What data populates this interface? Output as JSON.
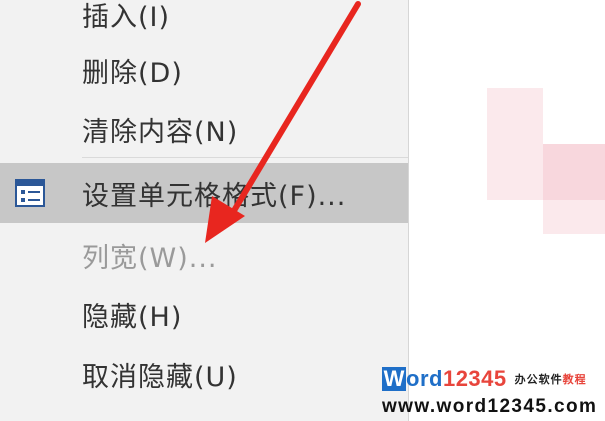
{
  "context_menu": {
    "items": [
      {
        "label": "插入(I)",
        "state": "normal"
      },
      {
        "label": "删除(D)",
        "state": "normal"
      },
      {
        "label": "清除内容(N)",
        "state": "normal"
      },
      {
        "label": "设置单元格格式(F)...",
        "state": "highlighted",
        "icon": "format-cells-icon"
      },
      {
        "label": "列宽(W)...",
        "state": "disabled"
      },
      {
        "label": "隐藏(H)",
        "state": "normal"
      },
      {
        "label": "取消隐藏(U)",
        "state": "normal"
      }
    ]
  },
  "annotation": {
    "arrow_color": "#e8261f",
    "points_to": "列宽(W)..."
  },
  "watermark": {
    "logo_letter": "W",
    "brand": "ord",
    "digits": "12345",
    "tagline_black": "办公软件",
    "tagline_red": "教程",
    "url": "www.word12345.com"
  },
  "colors": {
    "menu_bg": "#f2f2f2",
    "highlight_bg": "#c7c7c7",
    "text": "#333333",
    "disabled_text": "#9a9a9a",
    "cell_tint": "#fbe9ec",
    "brand_blue": "#1f6fc8",
    "brand_red": "#e8453c"
  }
}
